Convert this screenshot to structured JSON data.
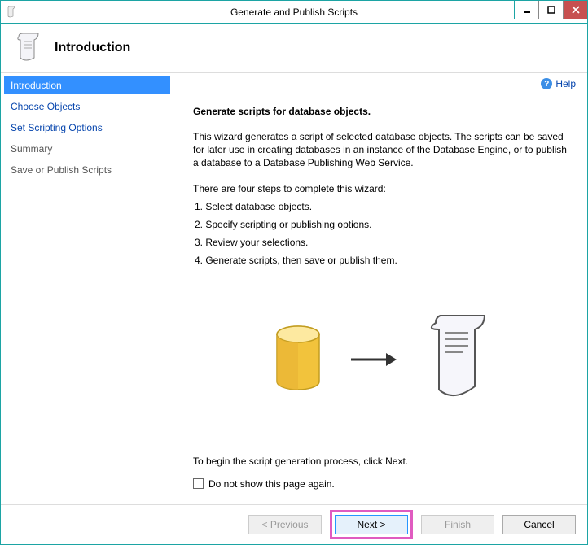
{
  "window": {
    "title": "Generate and Publish Scripts"
  },
  "header": {
    "title": "Introduction"
  },
  "help": {
    "label": "Help"
  },
  "sidebar": {
    "items": [
      {
        "label": "Introduction"
      },
      {
        "label": "Choose Objects"
      },
      {
        "label": "Set Scripting Options"
      },
      {
        "label": "Summary"
      },
      {
        "label": "Save or Publish Scripts"
      }
    ]
  },
  "main": {
    "subheading": "Generate scripts for database objects.",
    "description": "This wizard generates a script of selected database objects. The scripts can be saved for later use in creating databases in an instance of the Database Engine, or to publish a database to a Database Publishing Web Service.",
    "steps_intro": "There are four steps to complete this wizard:",
    "steps": [
      "1. Select database objects.",
      "2. Specify scripting or publishing options.",
      "3. Review your selections.",
      "4. Generate scripts, then save or publish them."
    ],
    "begin_text": "To begin the script generation process, click Next.",
    "checkbox_label": "Do not show this page again."
  },
  "buttons": {
    "previous": "< Previous",
    "next": "Next >",
    "finish": "Finish",
    "cancel": "Cancel"
  }
}
